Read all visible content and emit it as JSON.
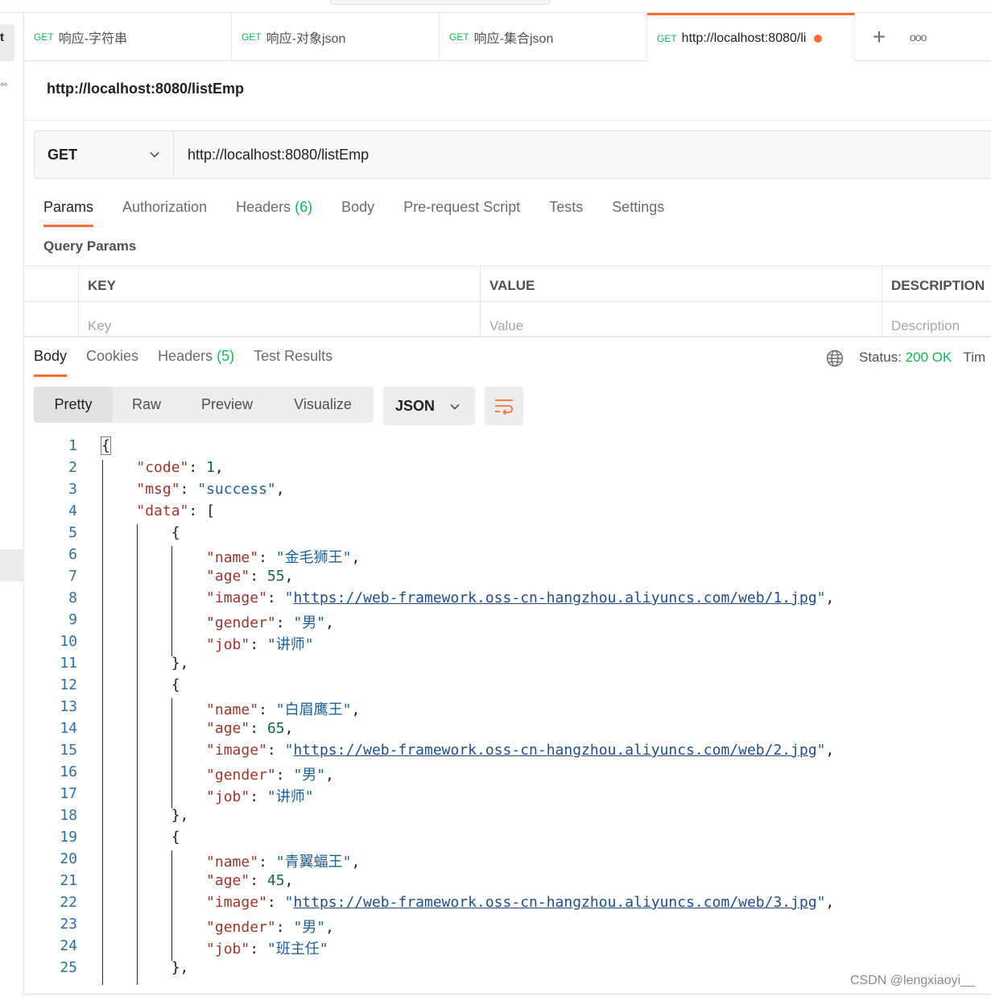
{
  "sidebar": {
    "cut_text": "t",
    "dots": "°°"
  },
  "tabs": [
    {
      "method": "GET",
      "label": "响应-字符串"
    },
    {
      "method": "GET",
      "label": "响应-对象json"
    },
    {
      "method": "GET",
      "label": "响应-集合json"
    },
    {
      "method": "GET",
      "label": "http://localhost:8080/li",
      "active": true,
      "unsaved": true
    }
  ],
  "tab_actions": {
    "add": "+",
    "more": "ooo"
  },
  "request": {
    "title": "http://localhost:8080/listEmp",
    "method": "GET",
    "url": "http://localhost:8080/listEmp"
  },
  "request_tabs": [
    {
      "label": "Params",
      "active": true
    },
    {
      "label": "Authorization"
    },
    {
      "label": "Headers",
      "count": "(6)"
    },
    {
      "label": "Body"
    },
    {
      "label": "Pre-request Script"
    },
    {
      "label": "Tests"
    },
    {
      "label": "Settings"
    }
  ],
  "query_params": {
    "label": "Query Params",
    "headers": [
      "KEY",
      "VALUE",
      "DESCRIPTION"
    ],
    "placeholders": [
      "Key",
      "Value",
      "Description"
    ]
  },
  "response_tabs": [
    {
      "label": "Body",
      "active": true
    },
    {
      "label": "Cookies"
    },
    {
      "label": "Headers",
      "count": "(5)"
    },
    {
      "label": "Test Results"
    }
  ],
  "status": {
    "label": "Status:",
    "value": "200 OK",
    "time_label": "Tim"
  },
  "format_buttons": [
    "Pretty",
    "Raw",
    "Preview",
    "Visualize"
  ],
  "format_active": "Pretty",
  "language": "JSON",
  "code_lines": [
    "{",
    "    \"code\": 1,",
    "    \"msg\": \"success\",",
    "    \"data\": [",
    "        {",
    "            \"name\": \"金毛狮王\",",
    "            \"age\": 55,",
    "            \"image\": \"https://web-framework.oss-cn-hangzhou.aliyuncs.com/web/1.jpg\",",
    "            \"gender\": \"男\",",
    "            \"job\": \"讲师\"",
    "        },",
    "        {",
    "            \"name\": \"白眉鹰王\",",
    "            \"age\": 65,",
    "            \"image\": \"https://web-framework.oss-cn-hangzhou.aliyuncs.com/web/2.jpg\",",
    "            \"gender\": \"男\",",
    "            \"job\": \"讲师\"",
    "        },",
    "        {",
    "            \"name\": \"青翼蝠王\",",
    "            \"age\": 45,",
    "            \"image\": \"https://web-framework.oss-cn-hangzhou.aliyuncs.com/web/3.jpg\",",
    "            \"gender\": \"男\",",
    "            \"job\": \"班主任\"",
    "        },"
  ],
  "watermark": "CSDN @lengxiaoyi__",
  "colors": {
    "accent": "#ff6c37",
    "method_get": "#0cbb52",
    "json_key": "#a1352b",
    "json_string": "#1f5f9a",
    "json_number": "#116644",
    "line_number": "#2b6fa8"
  }
}
